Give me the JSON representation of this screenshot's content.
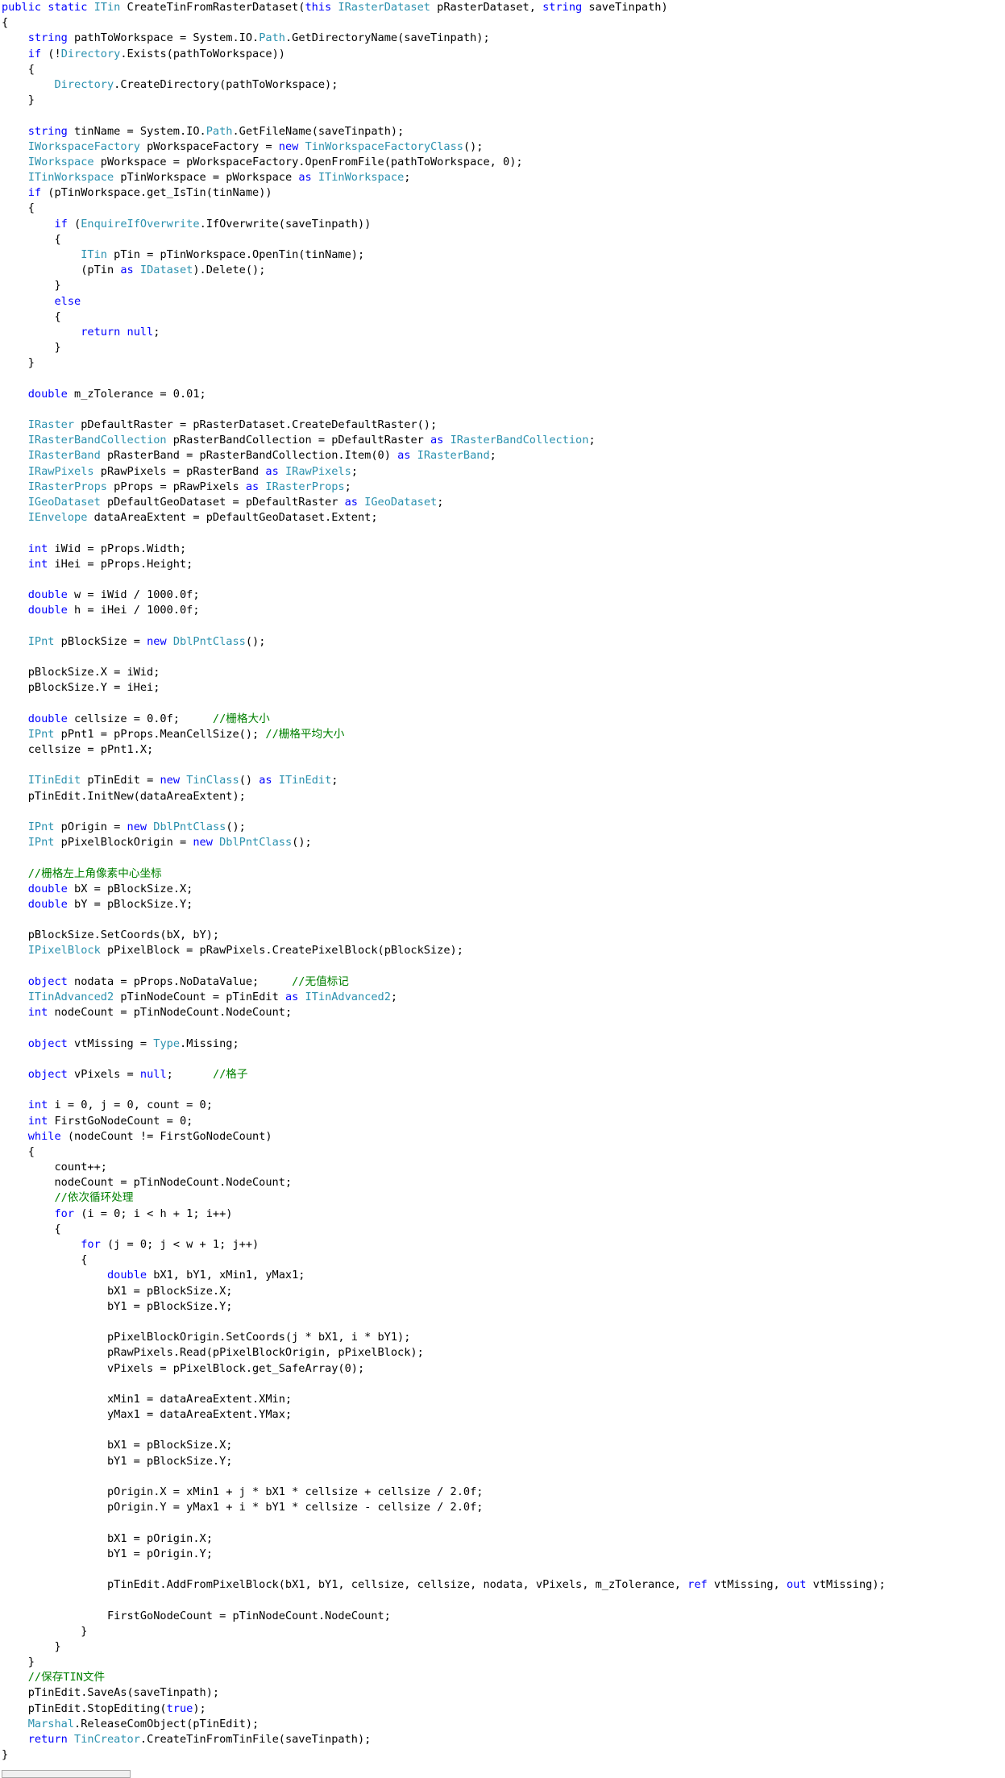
{
  "colors": {
    "keyword": "#0000ff",
    "type": "#2b91af",
    "comment": "#008000",
    "text": "#000000",
    "background": "#ffffff"
  },
  "code_lines": [
    [
      [
        "kw",
        "public static "
      ],
      [
        "type",
        "ITin"
      ],
      [
        "tx",
        " CreateTinFromRasterDataset("
      ],
      [
        "kw",
        "this "
      ],
      [
        "type",
        "IRasterDataset"
      ],
      [
        "tx",
        " pRasterDataset, "
      ],
      [
        "kw",
        "string"
      ],
      [
        "tx",
        " saveTinpath)"
      ]
    ],
    [
      [
        "tx",
        "{"
      ]
    ],
    [
      [
        "tx",
        "    "
      ],
      [
        "kw",
        "string"
      ],
      [
        "tx",
        " pathToWorkspace = System.IO."
      ],
      [
        "type",
        "Path"
      ],
      [
        "tx",
        ".GetDirectoryName(saveTinpath);"
      ]
    ],
    [
      [
        "tx",
        "    "
      ],
      [
        "kw",
        "if"
      ],
      [
        "tx",
        " (!"
      ],
      [
        "type",
        "Directory"
      ],
      [
        "tx",
        ".Exists(pathToWorkspace))"
      ]
    ],
    [
      [
        "tx",
        "    {"
      ]
    ],
    [
      [
        "tx",
        "        "
      ],
      [
        "type",
        "Directory"
      ],
      [
        "tx",
        ".CreateDirectory(pathToWorkspace);"
      ]
    ],
    [
      [
        "tx",
        "    }"
      ]
    ],
    [],
    [
      [
        "tx",
        "    "
      ],
      [
        "kw",
        "string"
      ],
      [
        "tx",
        " tinName = System.IO."
      ],
      [
        "type",
        "Path"
      ],
      [
        "tx",
        ".GetFileName(saveTinpath);"
      ]
    ],
    [
      [
        "tx",
        "    "
      ],
      [
        "type",
        "IWorkspaceFactory"
      ],
      [
        "tx",
        " pWorkspaceFactory = "
      ],
      [
        "kw",
        "new "
      ],
      [
        "type",
        "TinWorkspaceFactoryClass"
      ],
      [
        "tx",
        "();"
      ]
    ],
    [
      [
        "tx",
        "    "
      ],
      [
        "type",
        "IWorkspace"
      ],
      [
        "tx",
        " pWorkspace = pWorkspaceFactory.OpenFromFile(pathToWorkspace, 0);"
      ]
    ],
    [
      [
        "tx",
        "    "
      ],
      [
        "type",
        "ITinWorkspace"
      ],
      [
        "tx",
        " pTinWorkspace = pWorkspace "
      ],
      [
        "kw",
        "as "
      ],
      [
        "type",
        "ITinWorkspace"
      ],
      [
        "tx",
        ";"
      ]
    ],
    [
      [
        "tx",
        "    "
      ],
      [
        "kw",
        "if"
      ],
      [
        "tx",
        " (pTinWorkspace.get_IsTin(tinName))"
      ]
    ],
    [
      [
        "tx",
        "    {"
      ]
    ],
    [
      [
        "tx",
        "        "
      ],
      [
        "kw",
        "if"
      ],
      [
        "tx",
        " ("
      ],
      [
        "type",
        "EnquireIfOverwrite"
      ],
      [
        "tx",
        ".IfOverwrite(saveTinpath))"
      ]
    ],
    [
      [
        "tx",
        "        {"
      ]
    ],
    [
      [
        "tx",
        "            "
      ],
      [
        "type",
        "ITin"
      ],
      [
        "tx",
        " pTin = pTinWorkspace.OpenTin(tinName);"
      ]
    ],
    [
      [
        "tx",
        "            (pTin "
      ],
      [
        "kw",
        "as "
      ],
      [
        "type",
        "IDataset"
      ],
      [
        "tx",
        ").Delete();"
      ]
    ],
    [
      [
        "tx",
        "        }"
      ]
    ],
    [
      [
        "tx",
        "        "
      ],
      [
        "kw",
        "else"
      ]
    ],
    [
      [
        "tx",
        "        {"
      ]
    ],
    [
      [
        "tx",
        "            "
      ],
      [
        "kw",
        "return null"
      ],
      [
        "tx",
        ";"
      ]
    ],
    [
      [
        "tx",
        "        }"
      ]
    ],
    [
      [
        "tx",
        "    }"
      ]
    ],
    [],
    [
      [
        "tx",
        "    "
      ],
      [
        "kw",
        "double"
      ],
      [
        "tx",
        " m_zTolerance = 0.01;"
      ]
    ],
    [],
    [
      [
        "tx",
        "    "
      ],
      [
        "type",
        "IRaster"
      ],
      [
        "tx",
        " pDefaultRaster = pRasterDataset.CreateDefaultRaster();"
      ]
    ],
    [
      [
        "tx",
        "    "
      ],
      [
        "type",
        "IRasterBandCollection"
      ],
      [
        "tx",
        " pRasterBandCollection = pDefaultRaster "
      ],
      [
        "kw",
        "as "
      ],
      [
        "type",
        "IRasterBandCollection"
      ],
      [
        "tx",
        ";"
      ]
    ],
    [
      [
        "tx",
        "    "
      ],
      [
        "type",
        "IRasterBand"
      ],
      [
        "tx",
        " pRasterBand = pRasterBandCollection.Item(0) "
      ],
      [
        "kw",
        "as "
      ],
      [
        "type",
        "IRasterBand"
      ],
      [
        "tx",
        ";"
      ]
    ],
    [
      [
        "tx",
        "    "
      ],
      [
        "type",
        "IRawPixels"
      ],
      [
        "tx",
        " pRawPixels = pRasterBand "
      ],
      [
        "kw",
        "as "
      ],
      [
        "type",
        "IRawPixels"
      ],
      [
        "tx",
        ";"
      ]
    ],
    [
      [
        "tx",
        "    "
      ],
      [
        "type",
        "IRasterProps"
      ],
      [
        "tx",
        " pProps = pRawPixels "
      ],
      [
        "kw",
        "as "
      ],
      [
        "type",
        "IRasterProps"
      ],
      [
        "tx",
        ";"
      ]
    ],
    [
      [
        "tx",
        "    "
      ],
      [
        "type",
        "IGeoDataset"
      ],
      [
        "tx",
        " pDefaultGeoDataset = pDefaultRaster "
      ],
      [
        "kw",
        "as "
      ],
      [
        "type",
        "IGeoDataset"
      ],
      [
        "tx",
        ";"
      ]
    ],
    [
      [
        "tx",
        "    "
      ],
      [
        "type",
        "IEnvelope"
      ],
      [
        "tx",
        " dataAreaExtent = pDefaultGeoDataset.Extent;"
      ]
    ],
    [],
    [
      [
        "tx",
        "    "
      ],
      [
        "kw",
        "int"
      ],
      [
        "tx",
        " iWid = pProps.Width;"
      ]
    ],
    [
      [
        "tx",
        "    "
      ],
      [
        "kw",
        "int"
      ],
      [
        "tx",
        " iHei = pProps.Height;"
      ]
    ],
    [],
    [
      [
        "tx",
        "    "
      ],
      [
        "kw",
        "double"
      ],
      [
        "tx",
        " w = iWid / 1000.0f;"
      ]
    ],
    [
      [
        "tx",
        "    "
      ],
      [
        "kw",
        "double"
      ],
      [
        "tx",
        " h = iHei / 1000.0f;"
      ]
    ],
    [],
    [
      [
        "tx",
        "    "
      ],
      [
        "type",
        "IPnt"
      ],
      [
        "tx",
        " pBlockSize = "
      ],
      [
        "kw",
        "new "
      ],
      [
        "type",
        "DblPntClass"
      ],
      [
        "tx",
        "();"
      ]
    ],
    [],
    [
      [
        "tx",
        "    pBlockSize.X = iWid;"
      ]
    ],
    [
      [
        "tx",
        "    pBlockSize.Y = iHei;"
      ]
    ],
    [],
    [
      [
        "tx",
        "    "
      ],
      [
        "kw",
        "double"
      ],
      [
        "tx",
        " cellsize = 0.0f;     "
      ],
      [
        "cm",
        "//栅格大小"
      ]
    ],
    [
      [
        "tx",
        "    "
      ],
      [
        "type",
        "IPnt"
      ],
      [
        "tx",
        " pPnt1 = pProps.MeanCellSize(); "
      ],
      [
        "cm",
        "//栅格平均大小"
      ]
    ],
    [
      [
        "tx",
        "    cellsize = pPnt1.X;"
      ]
    ],
    [],
    [
      [
        "tx",
        "    "
      ],
      [
        "type",
        "ITinEdit"
      ],
      [
        "tx",
        " pTinEdit = "
      ],
      [
        "kw",
        "new "
      ],
      [
        "type",
        "TinClass"
      ],
      [
        "tx",
        "() "
      ],
      [
        "kw",
        "as "
      ],
      [
        "type",
        "ITinEdit"
      ],
      [
        "tx",
        ";"
      ]
    ],
    [
      [
        "tx",
        "    pTinEdit.InitNew(dataAreaExtent);"
      ]
    ],
    [],
    [
      [
        "tx",
        "    "
      ],
      [
        "type",
        "IPnt"
      ],
      [
        "tx",
        " pOrigin = "
      ],
      [
        "kw",
        "new "
      ],
      [
        "type",
        "DblPntClass"
      ],
      [
        "tx",
        "();"
      ]
    ],
    [
      [
        "tx",
        "    "
      ],
      [
        "type",
        "IPnt"
      ],
      [
        "tx",
        " pPixelBlockOrigin = "
      ],
      [
        "kw",
        "new "
      ],
      [
        "type",
        "DblPntClass"
      ],
      [
        "tx",
        "();"
      ]
    ],
    [],
    [
      [
        "tx",
        "    "
      ],
      [
        "cm",
        "//栅格左上角像素中心坐标"
      ]
    ],
    [
      [
        "tx",
        "    "
      ],
      [
        "kw",
        "double"
      ],
      [
        "tx",
        " bX = pBlockSize.X;"
      ]
    ],
    [
      [
        "tx",
        "    "
      ],
      [
        "kw",
        "double"
      ],
      [
        "tx",
        " bY = pBlockSize.Y;"
      ]
    ],
    [],
    [
      [
        "tx",
        "    pBlockSize.SetCoords(bX, bY);"
      ]
    ],
    [
      [
        "tx",
        "    "
      ],
      [
        "type",
        "IPixelBlock"
      ],
      [
        "tx",
        " pPixelBlock = pRawPixels.CreatePixelBlock(pBlockSize);"
      ]
    ],
    [],
    [
      [
        "tx",
        "    "
      ],
      [
        "kw",
        "object"
      ],
      [
        "tx",
        " nodata = pProps.NoDataValue;     "
      ],
      [
        "cm",
        "//无值标记"
      ]
    ],
    [
      [
        "tx",
        "    "
      ],
      [
        "type",
        "ITinAdvanced2"
      ],
      [
        "tx",
        " pTinNodeCount = pTinEdit "
      ],
      [
        "kw",
        "as "
      ],
      [
        "type",
        "ITinAdvanced2"
      ],
      [
        "tx",
        ";"
      ]
    ],
    [
      [
        "tx",
        "    "
      ],
      [
        "kw",
        "int"
      ],
      [
        "tx",
        " nodeCount = pTinNodeCount.NodeCount;"
      ]
    ],
    [],
    [
      [
        "tx",
        "    "
      ],
      [
        "kw",
        "object"
      ],
      [
        "tx",
        " vtMissing = "
      ],
      [
        "type",
        "Type"
      ],
      [
        "tx",
        ".Missing;"
      ]
    ],
    [],
    [
      [
        "tx",
        "    "
      ],
      [
        "kw",
        "object"
      ],
      [
        "tx",
        " vPixels = "
      ],
      [
        "kw",
        "null"
      ],
      [
        "tx",
        ";      "
      ],
      [
        "cm",
        "//格子"
      ]
    ],
    [],
    [
      [
        "tx",
        "    "
      ],
      [
        "kw",
        "int"
      ],
      [
        "tx",
        " i = 0, j = 0, count = 0;"
      ]
    ],
    [
      [
        "tx",
        "    "
      ],
      [
        "kw",
        "int"
      ],
      [
        "tx",
        " FirstGoNodeCount = 0;"
      ]
    ],
    [
      [
        "tx",
        "    "
      ],
      [
        "kw",
        "while"
      ],
      [
        "tx",
        " (nodeCount != FirstGoNodeCount)"
      ]
    ],
    [
      [
        "tx",
        "    {"
      ]
    ],
    [
      [
        "tx",
        "        count++;"
      ]
    ],
    [
      [
        "tx",
        "        nodeCount = pTinNodeCount.NodeCount;"
      ]
    ],
    [
      [
        "tx",
        "        "
      ],
      [
        "cm",
        "//依次循环处理"
      ]
    ],
    [
      [
        "tx",
        "        "
      ],
      [
        "kw",
        "for"
      ],
      [
        "tx",
        " (i = 0; i < h + 1; i++)"
      ]
    ],
    [
      [
        "tx",
        "        {"
      ]
    ],
    [
      [
        "tx",
        "            "
      ],
      [
        "kw",
        "for"
      ],
      [
        "tx",
        " (j = 0; j < w + 1; j++)"
      ]
    ],
    [
      [
        "tx",
        "            {"
      ]
    ],
    [
      [
        "tx",
        "                "
      ],
      [
        "kw",
        "double"
      ],
      [
        "tx",
        " bX1, bY1, xMin1, yMax1;"
      ]
    ],
    [
      [
        "tx",
        "                bX1 = pBlockSize.X;"
      ]
    ],
    [
      [
        "tx",
        "                bY1 = pBlockSize.Y;"
      ]
    ],
    [],
    [
      [
        "tx",
        "                pPixelBlockOrigin.SetCoords(j * bX1, i * bY1);"
      ]
    ],
    [
      [
        "tx",
        "                pRawPixels.Read(pPixelBlockOrigin, pPixelBlock);"
      ]
    ],
    [
      [
        "tx",
        "                vPixels = pPixelBlock.get_SafeArray(0);"
      ]
    ],
    [],
    [
      [
        "tx",
        "                xMin1 = dataAreaExtent.XMin;"
      ]
    ],
    [
      [
        "tx",
        "                yMax1 = dataAreaExtent.YMax;"
      ]
    ],
    [],
    [
      [
        "tx",
        "                bX1 = pBlockSize.X;"
      ]
    ],
    [
      [
        "tx",
        "                bY1 = pBlockSize.Y;"
      ]
    ],
    [],
    [
      [
        "tx",
        "                pOrigin.X = xMin1 + j * bX1 * cellsize + cellsize / 2.0f;"
      ]
    ],
    [
      [
        "tx",
        "                pOrigin.Y = yMax1 + i * bY1 * cellsize - cellsize / 2.0f;"
      ]
    ],
    [],
    [
      [
        "tx",
        "                bX1 = pOrigin.X;"
      ]
    ],
    [
      [
        "tx",
        "                bY1 = pOrigin.Y;"
      ]
    ],
    [],
    [
      [
        "tx",
        "                pTinEdit.AddFromPixelBlock(bX1, bY1, cellsize, cellsize, nodata, vPixels, m_zTolerance, "
      ],
      [
        "kw",
        "ref"
      ],
      [
        "tx",
        " vtMissing, "
      ],
      [
        "kw",
        "out"
      ],
      [
        "tx",
        " vtMissing);"
      ]
    ],
    [],
    [
      [
        "tx",
        "                FirstGoNodeCount = pTinNodeCount.NodeCount;"
      ]
    ],
    [
      [
        "tx",
        "            }"
      ]
    ],
    [
      [
        "tx",
        "        }"
      ]
    ],
    [
      [
        "tx",
        "    }"
      ]
    ],
    [
      [
        "tx",
        "    "
      ],
      [
        "cm",
        "//保存TIN文件"
      ]
    ],
    [
      [
        "tx",
        "    pTinEdit.SaveAs(saveTinpath);"
      ]
    ],
    [
      [
        "tx",
        "    pTinEdit.StopEditing("
      ],
      [
        "kw",
        "true"
      ],
      [
        "tx",
        ");"
      ]
    ],
    [
      [
        "tx",
        "    "
      ],
      [
        "type",
        "Marshal"
      ],
      [
        "tx",
        ".ReleaseComObject(pTinEdit);"
      ]
    ],
    [
      [
        "tx",
        "    "
      ],
      [
        "kw",
        "return "
      ],
      [
        "type",
        "TinCreator"
      ],
      [
        "tx",
        ".CreateTinFromTinFile(saveTinpath);"
      ]
    ],
    [
      [
        "tx",
        "}"
      ]
    ]
  ]
}
